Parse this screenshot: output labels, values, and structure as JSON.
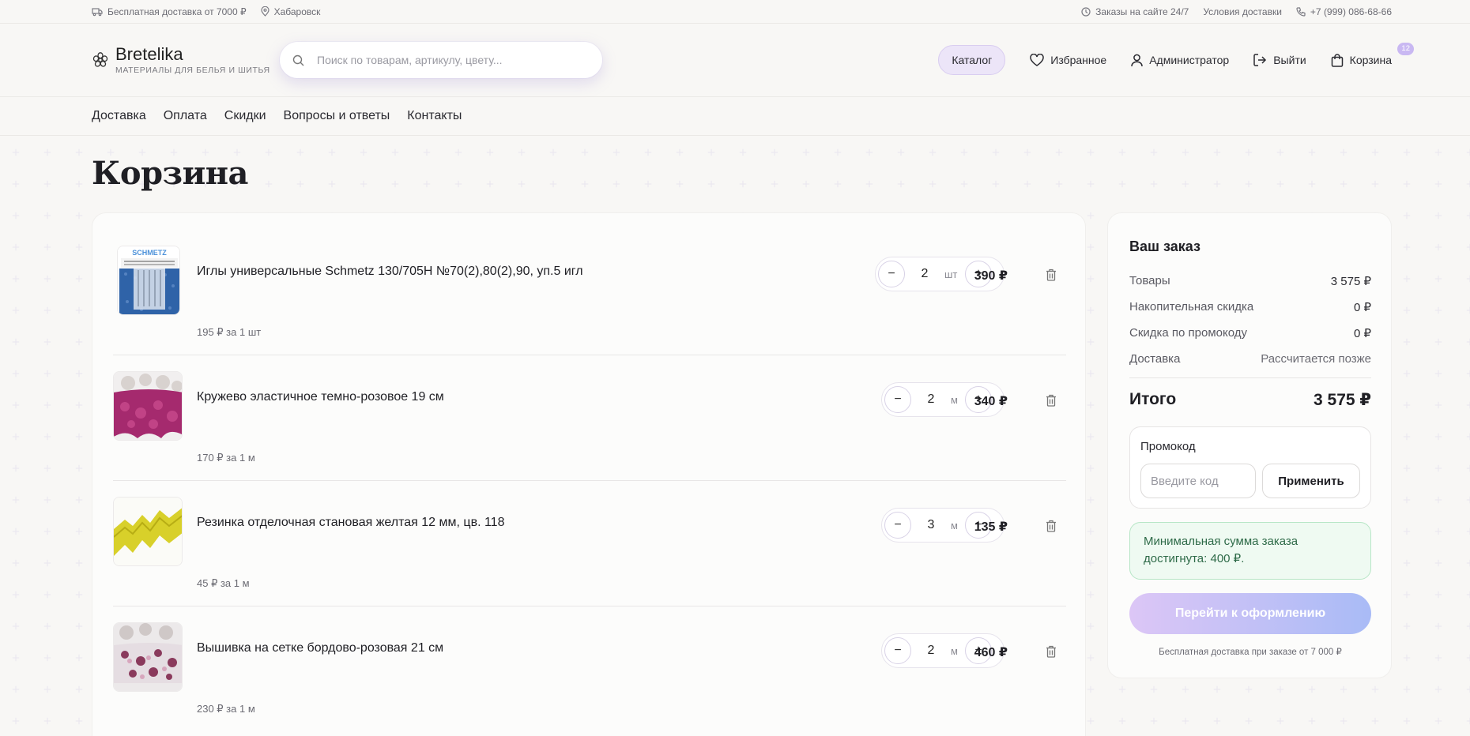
{
  "topbar": {
    "shipping": "Бесплатная доставка от 7000 ₽",
    "city": "Хабаровск",
    "orders": "Заказы на сайте 24/7",
    "delivery_terms": "Условия доставки",
    "phone": "+7 (999) 086-68-66"
  },
  "header": {
    "brand": "Bretelika",
    "tagline": "МАТЕРИАЛЫ ДЛЯ БЕЛЬЯ И ШИТЬЯ",
    "search_placeholder": "Поиск по товарам, артикулу, цвету...",
    "catalog": "Каталог",
    "favorites": "Избранное",
    "admin": "Администратор",
    "logout": "Выйти",
    "cart": "Корзина",
    "cart_count": "12"
  },
  "menu": [
    "Доставка",
    "Оплата",
    "Скидки",
    "Вопросы и ответы",
    "Контакты"
  ],
  "page": {
    "title": "Корзина"
  },
  "items": [
    {
      "name": "Иглы универсальные Schmetz 130/705H №70(2),80(2),90, уп.5 игл",
      "unit_price": "195 ₽ за 1 шт",
      "qty": "2",
      "unit": "шт",
      "total": "390 ₽",
      "thumb_label": "SCHMETZ"
    },
    {
      "name": "Кружево эластичное темно-розовое 19 см",
      "unit_price": "170 ₽ за 1 м",
      "qty": "2",
      "unit": "м",
      "total": "340 ₽"
    },
    {
      "name": "Резинка отделочная становая желтая 12 мм, цв. 118",
      "unit_price": "45 ₽ за 1 м",
      "qty": "3",
      "unit": "м",
      "total": "135 ₽"
    },
    {
      "name": "Вышивка на сетке бордово-розовая 21 см",
      "unit_price": "230 ₽ за 1 м",
      "qty": "2",
      "unit": "м",
      "total": "460 ₽"
    }
  ],
  "summary": {
    "title": "Ваш заказ",
    "rows": [
      {
        "label": "Товары",
        "value": "3 575 ₽"
      },
      {
        "label": "Накопительная скидка",
        "value": "0 ₽"
      },
      {
        "label": "Скидка по промокоду",
        "value": "0 ₽"
      },
      {
        "label": "Доставка",
        "value": "Рассчитается позже"
      }
    ],
    "total_label": "Итого",
    "total_value": "3 575 ₽",
    "promo_label": "Промокод",
    "promo_placeholder": "Введите код",
    "apply": "Применить",
    "notice": "Минимальная сумма заказа достигнута: 400 ₽.",
    "checkout": "Перейти к оформлению",
    "footnote": "Бесплатная доставка при заказе от 7 000 ₽"
  },
  "colors": {
    "accent": "#ece5f8",
    "checkout_from": "#dcc6f6",
    "checkout_to": "#a9bbf6",
    "success_bg": "#effaf2"
  }
}
